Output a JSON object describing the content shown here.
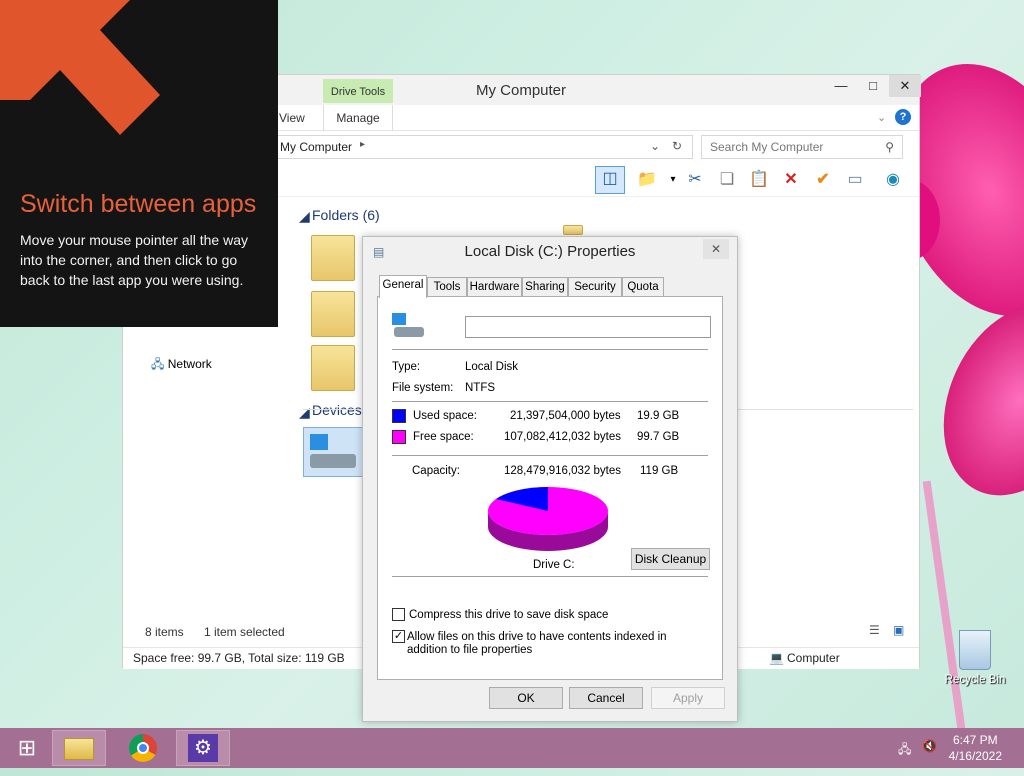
{
  "explorer": {
    "title": "My Computer",
    "drive_tools": "Drive Tools",
    "tab_view": "View",
    "tab_manage": "Manage",
    "address": "My Computer",
    "search_placeholder": "Search My Computer",
    "folders_header": "Folders (6)",
    "devices_header": "Devices",
    "nav_network": "Network",
    "status_items": "8 items",
    "status_selected": "1 item selected",
    "bottom_space": "Space free: 99.7 GB, Total size: 119 GB",
    "bottom_computer": "Computer"
  },
  "charm_tip": {
    "title": "Switch between apps",
    "body": "Move your mouse pointer all the way into the corner, and then click to go back to the last app you were using."
  },
  "dialog": {
    "title": "Local Disk (C:) Properties",
    "tabs": [
      "General",
      "Tools",
      "Hardware",
      "Sharing",
      "Security",
      "Quota"
    ],
    "name_value": "",
    "type_label": "Type:",
    "type_value": "Local Disk",
    "fs_label": "File system:",
    "fs_value": "NTFS",
    "used_label": "Used space:",
    "used_bytes": "21,397,504,000 bytes",
    "used_gb": "19.9 GB",
    "free_label": "Free space:",
    "free_bytes": "107,082,412,032 bytes",
    "free_gb": "99.7 GB",
    "capacity_label": "Capacity:",
    "capacity_bytes": "128,479,916,032 bytes",
    "capacity_gb": "119 GB",
    "drive_label": "Drive C:",
    "cleanup": "Disk Cleanup",
    "compress_label": "Compress this drive to save disk space",
    "compress_checked": false,
    "index_label": "Allow files on this drive to have contents indexed in addition to file properties",
    "index_checked": true,
    "ok": "OK",
    "cancel": "Cancel",
    "apply": "Apply",
    "used_color": "#0000ff",
    "free_color": "#ff00ff",
    "used_fraction": 0.1666
  },
  "desktop": {
    "recycle_bin": "Recycle Bin"
  },
  "taskbar": {
    "time": "6:47 PM",
    "date": "4/16/2022",
    "items": [
      "start-icon",
      "file-explorer-icon",
      "chrome-icon",
      "settings-icon"
    ]
  }
}
